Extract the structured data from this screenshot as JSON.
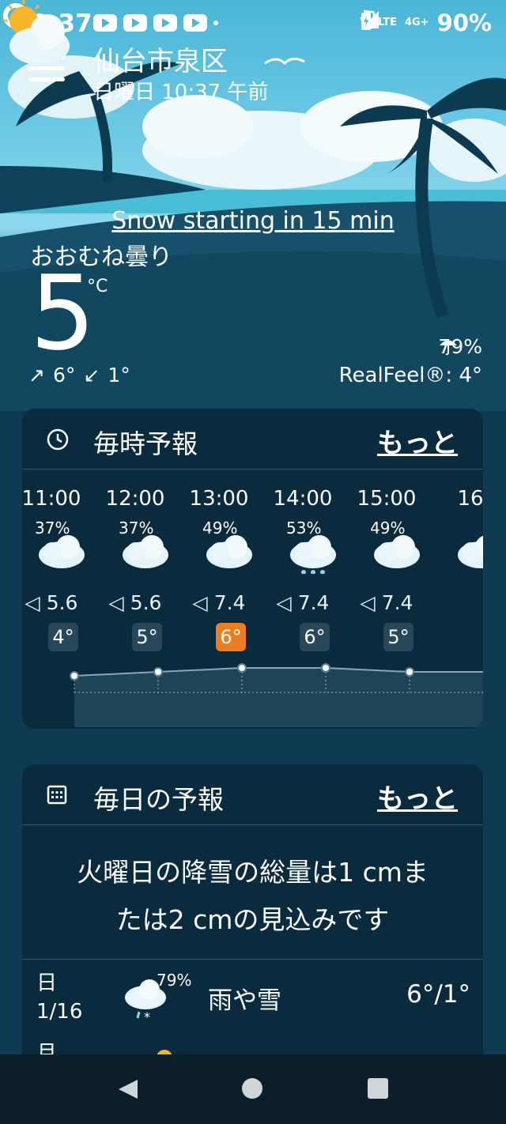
{
  "status_bar": {
    "time": "10:37",
    "network": "4G+",
    "volte": "Vo LTE",
    "battery": "90%"
  },
  "header": {
    "city": "仙台市泉区",
    "datetime": "日曜日 10:37 午前"
  },
  "current": {
    "alert": "Snow starting in 15 min",
    "condition": "おおむね曇り",
    "temperature": "5",
    "unit": "°C",
    "high": "6°",
    "low": "1°",
    "precip": "79%",
    "realfeel": "RealFeel®: 4°",
    "icon": "partly-cloudy-icon"
  },
  "hourly": {
    "title": "毎時予報",
    "more": "もっと",
    "hours": [
      {
        "time": "11:00",
        "precip": "37%",
        "wind": "5.6",
        "temp": "4°",
        "icon": "cloud-icon"
      },
      {
        "time": "12:00",
        "precip": "37%",
        "wind": "5.6",
        "temp": "5°",
        "icon": "cloud-icon"
      },
      {
        "time": "13:00",
        "precip": "49%",
        "wind": "7.4",
        "temp": "6°",
        "icon": "cloud-icon"
      },
      {
        "time": "14:00",
        "precip": "53%",
        "wind": "7.4",
        "temp": "6°",
        "icon": "rain-cloud-icon"
      },
      {
        "time": "15:00",
        "precip": "49%",
        "wind": "7.4",
        "temp": "5°",
        "icon": "cloud-icon"
      },
      {
        "time": "16",
        "precip": "",
        "wind": "",
        "temp": "",
        "icon": "cloud-icon"
      }
    ]
  },
  "daily": {
    "title": "毎日の予報",
    "more": "もっと",
    "summary_line1": "火曜日の降雪の総量は1 cmま",
    "summary_line2": "たは2 cmの見込みです",
    "days": [
      {
        "day": "日",
        "date": "1/16",
        "precip": "79%",
        "condition": "雨や雪",
        "temps": "6°/1°",
        "icon": "snow-rain-icon"
      },
      {
        "day": "月",
        "date": "",
        "precip": "",
        "condition": "",
        "temps": "",
        "icon": "sun-icon"
      }
    ]
  },
  "colors": {
    "accent_orange": "#ee7d1f",
    "card_bg": "#0a2b3d",
    "page_bg": "#0e3a52"
  }
}
